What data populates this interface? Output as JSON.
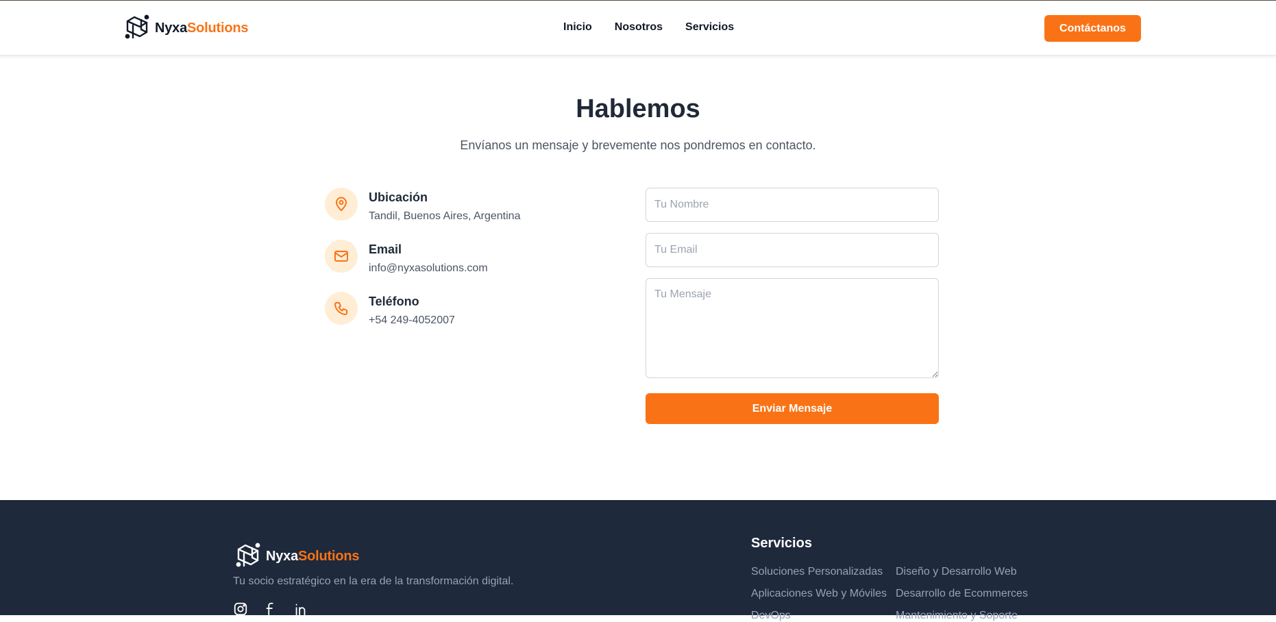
{
  "brand": {
    "name_part1": "Nyxa",
    "name_part2": "Solutions",
    "accent": "#f97316"
  },
  "nav": {
    "items": [
      {
        "label": "Inicio"
      },
      {
        "label": "Nosotros"
      },
      {
        "label": "Servicios"
      }
    ]
  },
  "header": {
    "cta_label": "Contáctanos"
  },
  "contact": {
    "title": "Hablemos",
    "subtitle": "Envíanos un mensaje y brevemente nos pondremos en contacto.",
    "info": [
      {
        "icon": "map-pin-icon",
        "title": "Ubicación",
        "value": "Tandil, Buenos Aires, Argentina"
      },
      {
        "icon": "mail-icon",
        "title": "Email",
        "value": "info@nyxasolutions.com"
      },
      {
        "icon": "phone-icon",
        "title": "Teléfono",
        "value": "+54 249-4052007"
      }
    ],
    "form": {
      "name_placeholder": "Tu Nombre",
      "email_placeholder": "Tu Email",
      "message_placeholder": "Tu Mensaje",
      "submit_label": "Enviar Mensaje"
    }
  },
  "footer": {
    "tagline": "Tu socio estratégico en la era de la transformación digital.",
    "social": [
      "instagram-icon",
      "facebook-icon",
      "linkedin-icon"
    ],
    "services_heading": "Servicios",
    "services": [
      "Soluciones Personalizadas",
      "Diseño y Desarrollo Web",
      "Aplicaciones Web y Móviles",
      "Desarrollo de Ecommerces",
      "DevOps",
      "Mantenimiento y Soporte"
    ]
  },
  "colors": {
    "footer_bg": "#1e293b",
    "icon_bg": "#ffedd5",
    "text_dark": "#1f2937"
  }
}
